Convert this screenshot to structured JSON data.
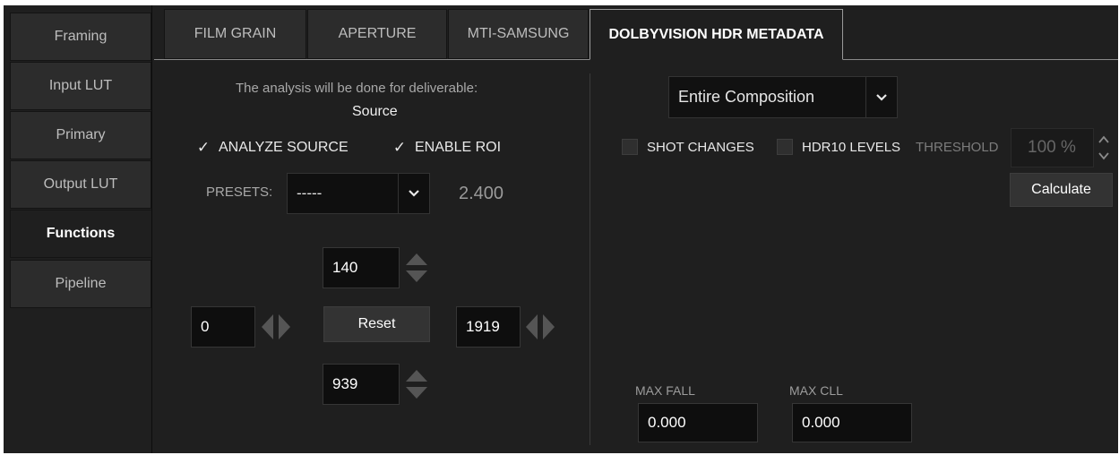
{
  "sidebar": {
    "items": [
      {
        "label": "Framing"
      },
      {
        "label": "Input LUT"
      },
      {
        "label": "Primary"
      },
      {
        "label": "Output LUT"
      },
      {
        "label": "Functions",
        "active": true
      },
      {
        "label": "Pipeline"
      }
    ]
  },
  "tabs": [
    {
      "label": "FILM GRAIN"
    },
    {
      "label": "APERTURE"
    },
    {
      "label": "MTI-SAMSUNG"
    },
    {
      "label": "DOLBYVISION HDR METADATA",
      "active": true
    }
  ],
  "left_panel": {
    "analysis_text": "The analysis will be done for deliverable:",
    "deliverable": "Source",
    "analyze_source_label": "ANALYZE SOURCE",
    "analyze_source_checked": true,
    "enable_roi_label": "ENABLE ROI",
    "enable_roi_checked": true,
    "presets_label": "PRESETS:",
    "presets_value": "-----",
    "aspect_value": "2.400",
    "roi": {
      "top": "140",
      "left": "0",
      "right": "1919",
      "bottom": "939",
      "reset_label": "Reset"
    }
  },
  "right_panel": {
    "scope_value": "Entire Composition",
    "shot_changes_label": "SHOT CHANGES",
    "shot_changes_checked": false,
    "hdr10_label": "HDR10 LEVELS",
    "hdr10_checked": false,
    "threshold_label": "THRESHOLD",
    "threshold_value": "100 %",
    "calculate_label": "Calculate",
    "max_fall_label": "MAX FALL",
    "max_fall_value": "0.000",
    "max_cll_label": "MAX CLL",
    "max_cll_value": "0.000"
  },
  "icons": {
    "check": "check-icon",
    "dropdown": "chevron-down-icon",
    "spin": "spin-arrows-icon",
    "left_right": "left-right-arrows-icon"
  },
  "colors": {
    "background": "#1f1f1f",
    "field": "#0e0e0e",
    "tab": "#2c2c2c",
    "text": "#d6d6d6",
    "muted": "#a8a8a8",
    "arrow": "#5a5a5a"
  }
}
